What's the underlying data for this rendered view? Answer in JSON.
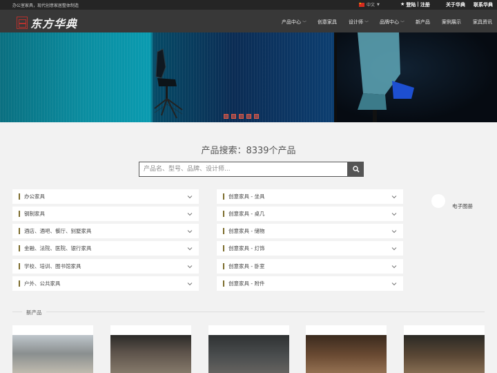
{
  "topbar": {
    "tagline": "办公室家具，现代创意家居整体制造",
    "language": "中文",
    "login": "登陆",
    "register": "注册",
    "separator": "|",
    "about": "关于华典",
    "contact": "联系华典"
  },
  "logo": {
    "text": "东方华典"
  },
  "nav": {
    "items": [
      {
        "label": "产品中心",
        "has_dropdown": true
      },
      {
        "label": "创意家具",
        "has_dropdown": false
      },
      {
        "label": "设计师",
        "has_dropdown": true
      },
      {
        "label": "品牌中心",
        "has_dropdown": true
      },
      {
        "label": "新产品",
        "has_dropdown": false
      },
      {
        "label": "案例展示",
        "has_dropdown": false
      },
      {
        "label": "家具资讯",
        "has_dropdown": false
      }
    ]
  },
  "banner": {
    "slide_count": 5
  },
  "search": {
    "title": "产品搜索：8339个产品",
    "placeholder": "产品名、型号、品牌、设计师..."
  },
  "categories_left": [
    "办公家具",
    "钢制家具",
    "酒店、酒吧、餐厅、别墅家具",
    "金融、法院、医院、银行家具",
    "学校、培训、图书馆家具",
    "户外、公共家具"
  ],
  "categories_right": [
    "创意家具 - 坐具",
    "创意家具 - 桌几",
    "创意家具 - 储物",
    "创意家具 - 灯饰",
    "创意家具 - 卧室",
    "创意家具 - 附件"
  ],
  "ebook": {
    "label": "电子图册"
  },
  "new_products": {
    "label": "新产品"
  },
  "colors": {
    "topbar": "#252525",
    "navbar": "#383838",
    "accent_bar": "#7a6a2a",
    "slider_dot": "#e25a46",
    "logo_seal": "#b8322e"
  }
}
